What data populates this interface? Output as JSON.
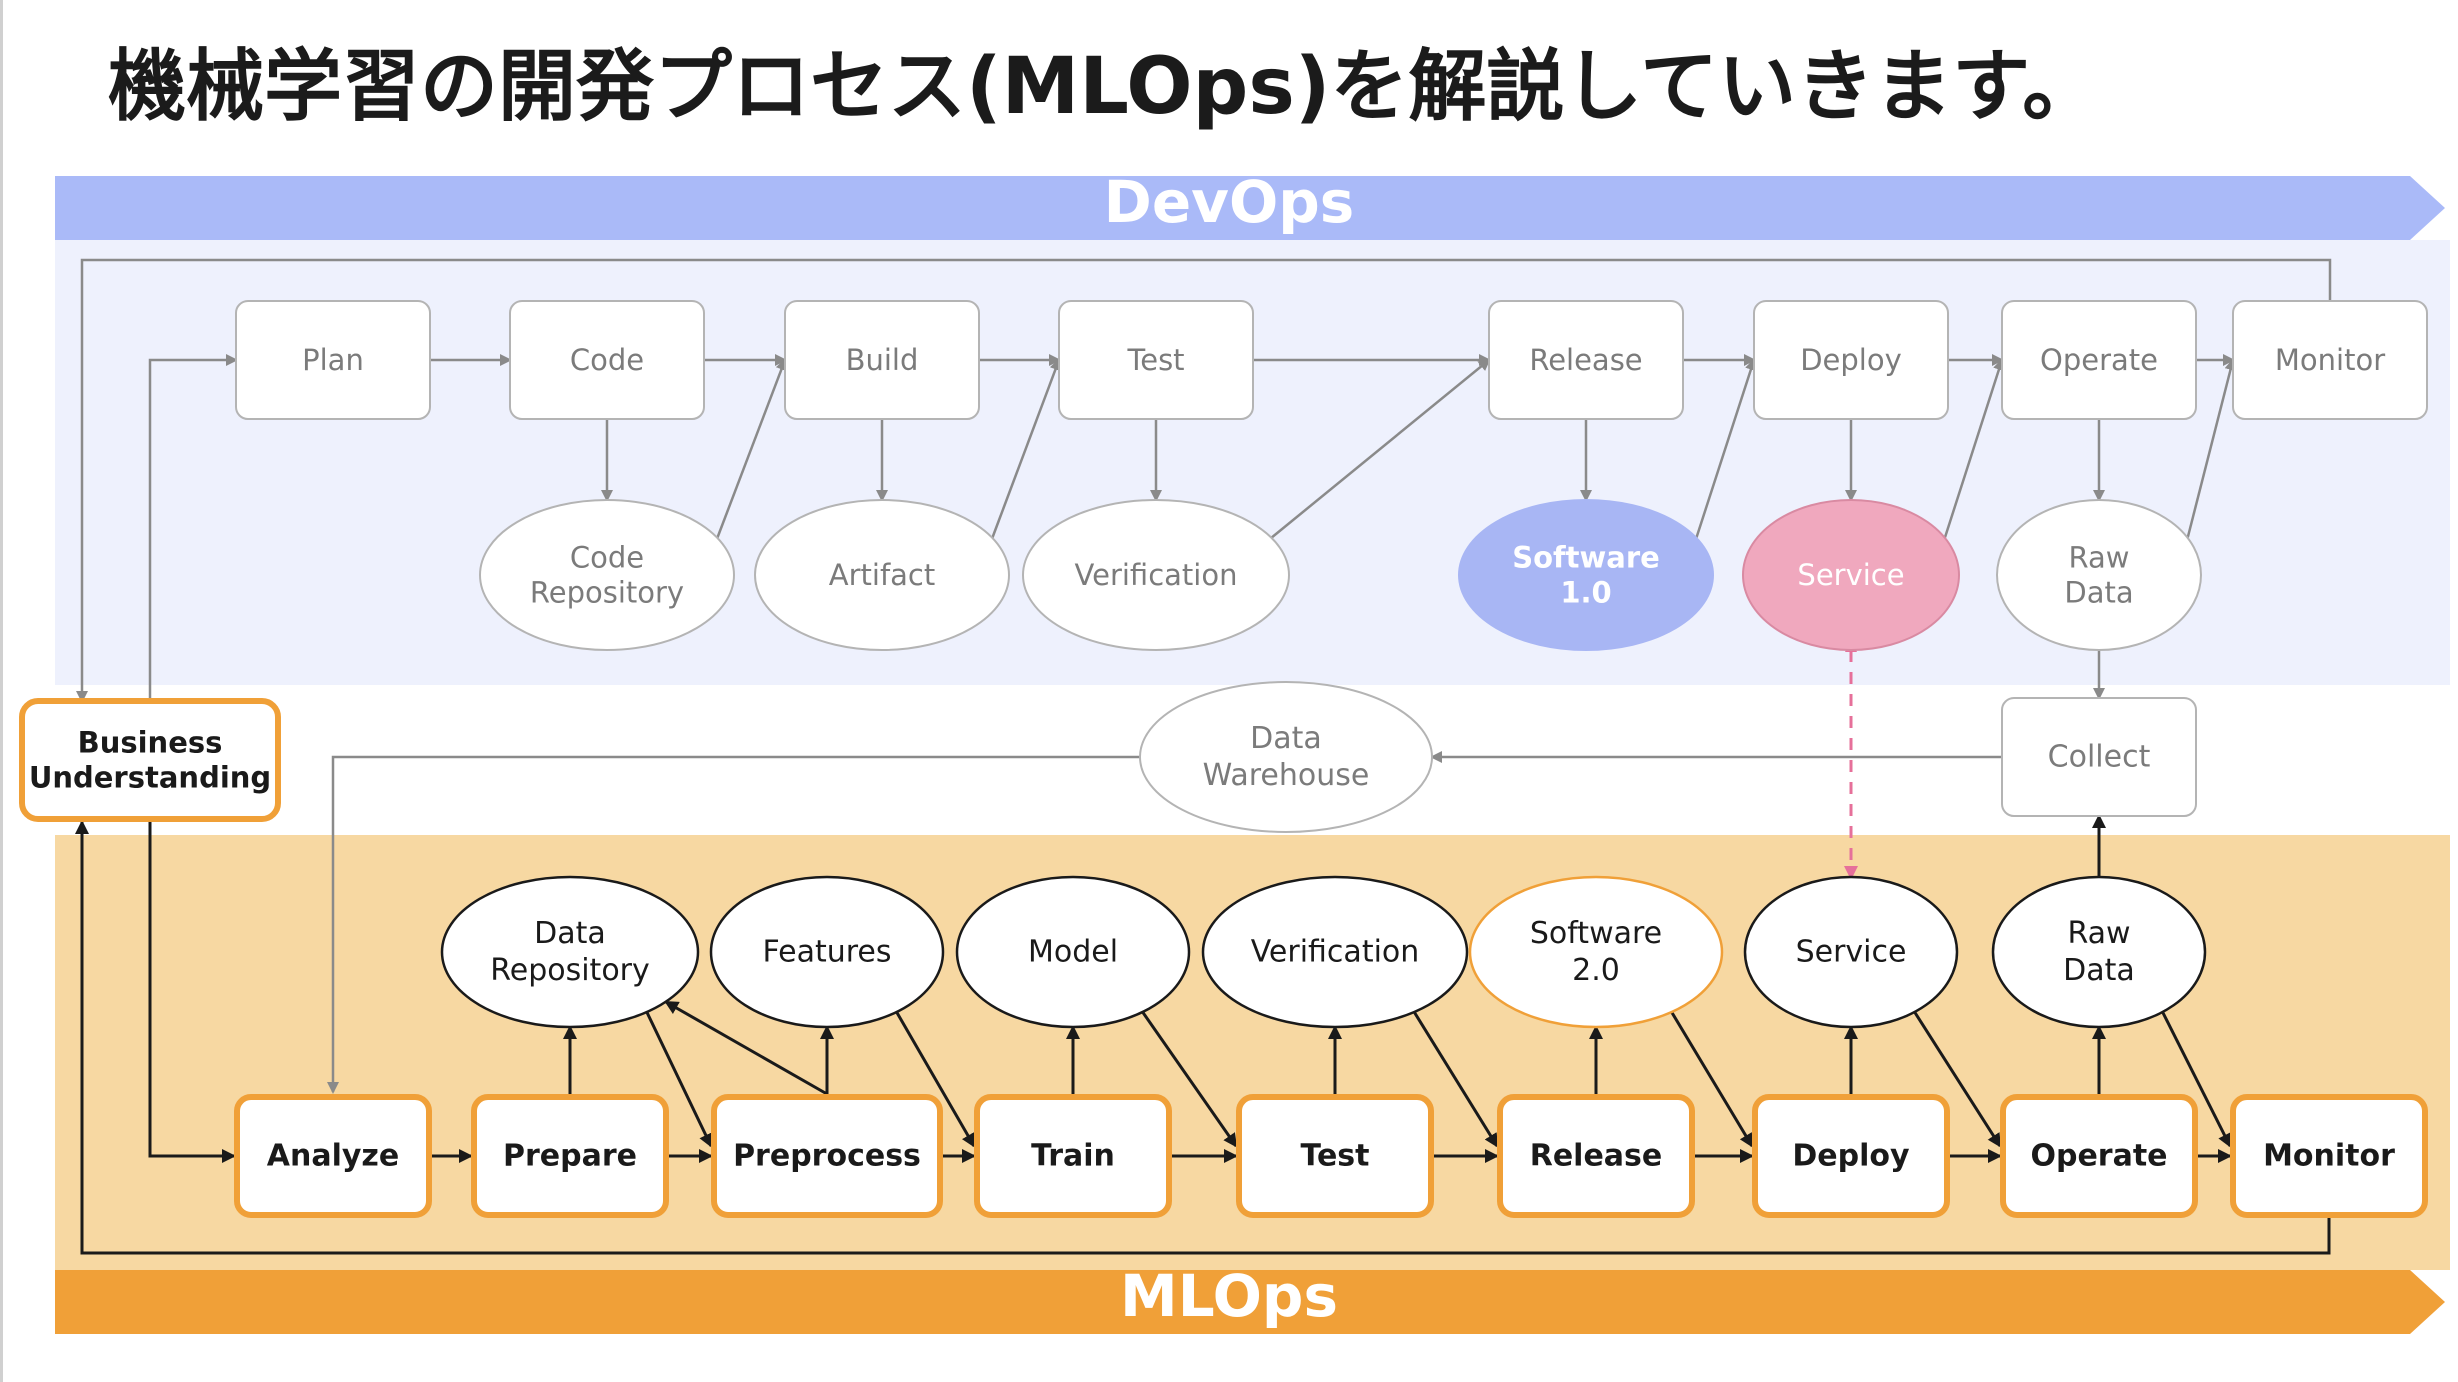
{
  "title": "機械学習の開発プロセス(MLOps)を解説していきます。",
  "bands": {
    "devops_label": "DevOps",
    "mlops_label": "MLOps"
  },
  "colors": {
    "devops_banner": "#AABAF8",
    "devops_area": "#EEF1FD",
    "mlops_banner": "#F0A038",
    "mlops_area": "#F7D8A2",
    "orange_border": "#F0A038",
    "software1_fill": "#A8B6F4",
    "service_fill": "#F0A8BE"
  },
  "business_understanding": {
    "lines": [
      "Business",
      "Understanding"
    ]
  },
  "devops": {
    "steps": [
      "Plan",
      "Code",
      "Build",
      "Test",
      "Release",
      "Deploy",
      "Operate",
      "Monitor"
    ],
    "artifacts": [
      {
        "lines": [
          "Code",
          "Repository"
        ]
      },
      {
        "lines": [
          "Artifact"
        ]
      },
      {
        "lines": [
          "Verification"
        ]
      },
      {
        "lines": [
          "Software",
          "1.0"
        ]
      },
      {
        "lines": [
          "Service"
        ]
      },
      {
        "lines": [
          "Raw",
          "Data"
        ]
      }
    ]
  },
  "middle": {
    "data_warehouse": {
      "lines": [
        "Data",
        "Warehouse"
      ]
    },
    "collect": "Collect"
  },
  "mlops": {
    "steps": [
      "Analyze",
      "Prepare",
      "Preprocess",
      "Train",
      "Test",
      "Release",
      "Deploy",
      "Operate",
      "Monitor"
    ],
    "artifacts": [
      {
        "lines": [
          "Data",
          "Repository"
        ]
      },
      {
        "lines": [
          "Features"
        ]
      },
      {
        "lines": [
          "Model"
        ]
      },
      {
        "lines": [
          "Verification"
        ]
      },
      {
        "lines": [
          "Software",
          "2.0"
        ]
      },
      {
        "lines": [
          "Service"
        ]
      },
      {
        "lines": [
          "Raw",
          "Data"
        ]
      }
    ]
  }
}
